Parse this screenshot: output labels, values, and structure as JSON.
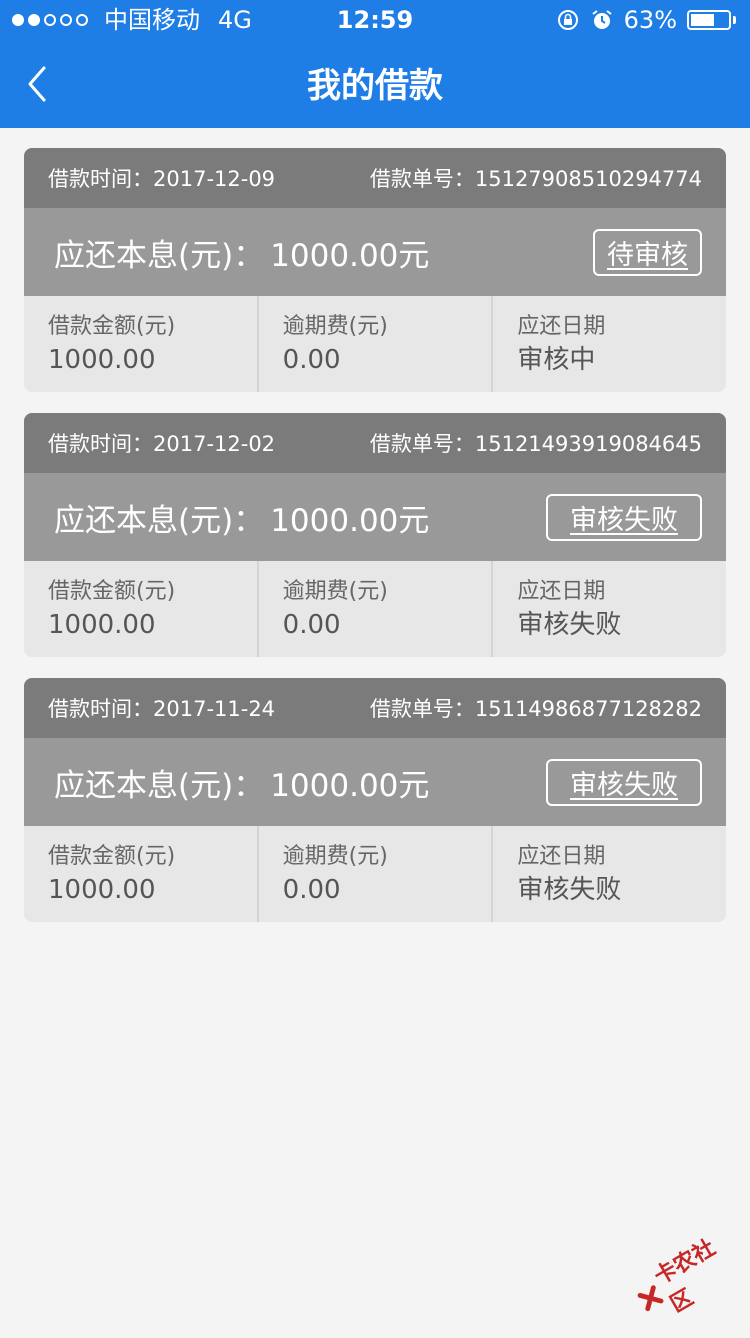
{
  "status_bar": {
    "carrier": "中国移动",
    "network": "4G",
    "time": "12:59",
    "battery": "63%",
    "battery_level": 0.63,
    "signal_bars_on": 2,
    "signal_bars_total": 5
  },
  "nav": {
    "title": "我的借款"
  },
  "labels": {
    "loan_time": "借款时间：",
    "order_no": "借款单号：",
    "principal_interest": "应还本息(元)：",
    "loan_amount": "借款金额(元)",
    "overdue_fee": "逾期费(元)",
    "due_date": "应还日期"
  },
  "loans": [
    {
      "date": "2017-12-09",
      "order": "15127908510294774",
      "amount_due": "1000.00元",
      "status": "待审核",
      "loan_amount": "1000.00",
      "overdue_fee": "0.00",
      "due_date": "审核中"
    },
    {
      "date": "2017-12-02",
      "order": "15121493919084645",
      "amount_due": "1000.00元",
      "status": "审核失败",
      "loan_amount": "1000.00",
      "overdue_fee": "0.00",
      "due_date": "审核失败"
    },
    {
      "date": "2017-11-24",
      "order": "15114986877128282",
      "amount_due": "1000.00元",
      "status": "审核失败",
      "loan_amount": "1000.00",
      "overdue_fee": "0.00",
      "due_date": "审核失败"
    }
  ],
  "watermark": "卡农社区",
  "colors": {
    "header": "#1f7ee6",
    "card_head": "#7b7b7b",
    "card_main": "#999999",
    "card_body": "#e7e7e7",
    "background": "#f4f4f4"
  }
}
